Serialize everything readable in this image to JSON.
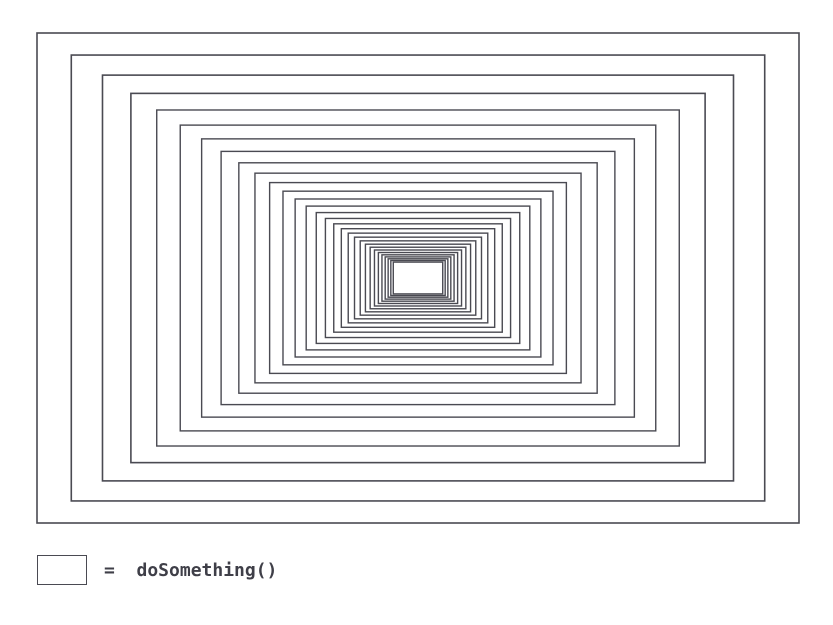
{
  "diagram": {
    "stroke_color": "#4a4a52",
    "background_color": "#ffffff",
    "nested_rectangle_count": 30
  },
  "legend": {
    "label": "=  doSomething()"
  }
}
